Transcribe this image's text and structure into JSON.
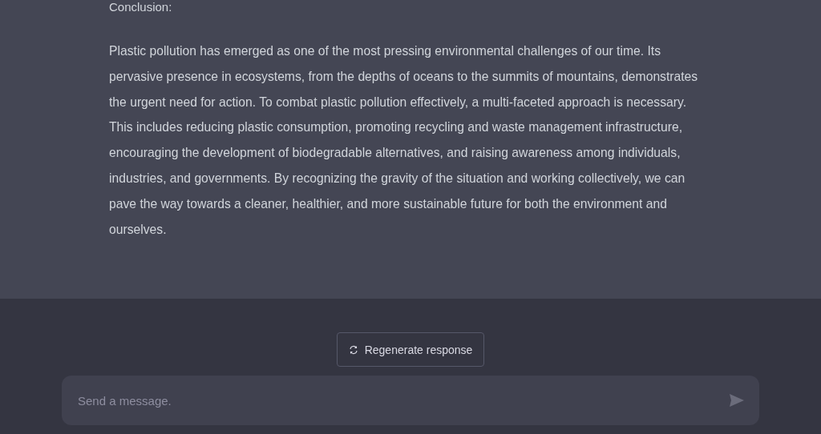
{
  "message": {
    "heading": "Conclusion:",
    "paragraph": "Plastic pollution has emerged as one of the most pressing environmental challenges of our time. Its pervasive presence in ecosystems, from the depths of oceans to the summits of mountains, demonstrates the urgent need for action. To combat plastic pollution effectively, a multi-faceted approach is necessary. This includes reducing plastic consumption, promoting recycling and waste management infrastructure, encouraging the development of biodegradable alternatives, and raising awareness among individuals, industries, and governments. By recognizing the gravity of the situation and working collectively, we can pave the way towards a cleaner, healthier, and more sustainable future for both the environment and ourselves."
  },
  "regenerate_button": {
    "label": "Regenerate response"
  },
  "composer": {
    "placeholder": "Send a message."
  }
}
